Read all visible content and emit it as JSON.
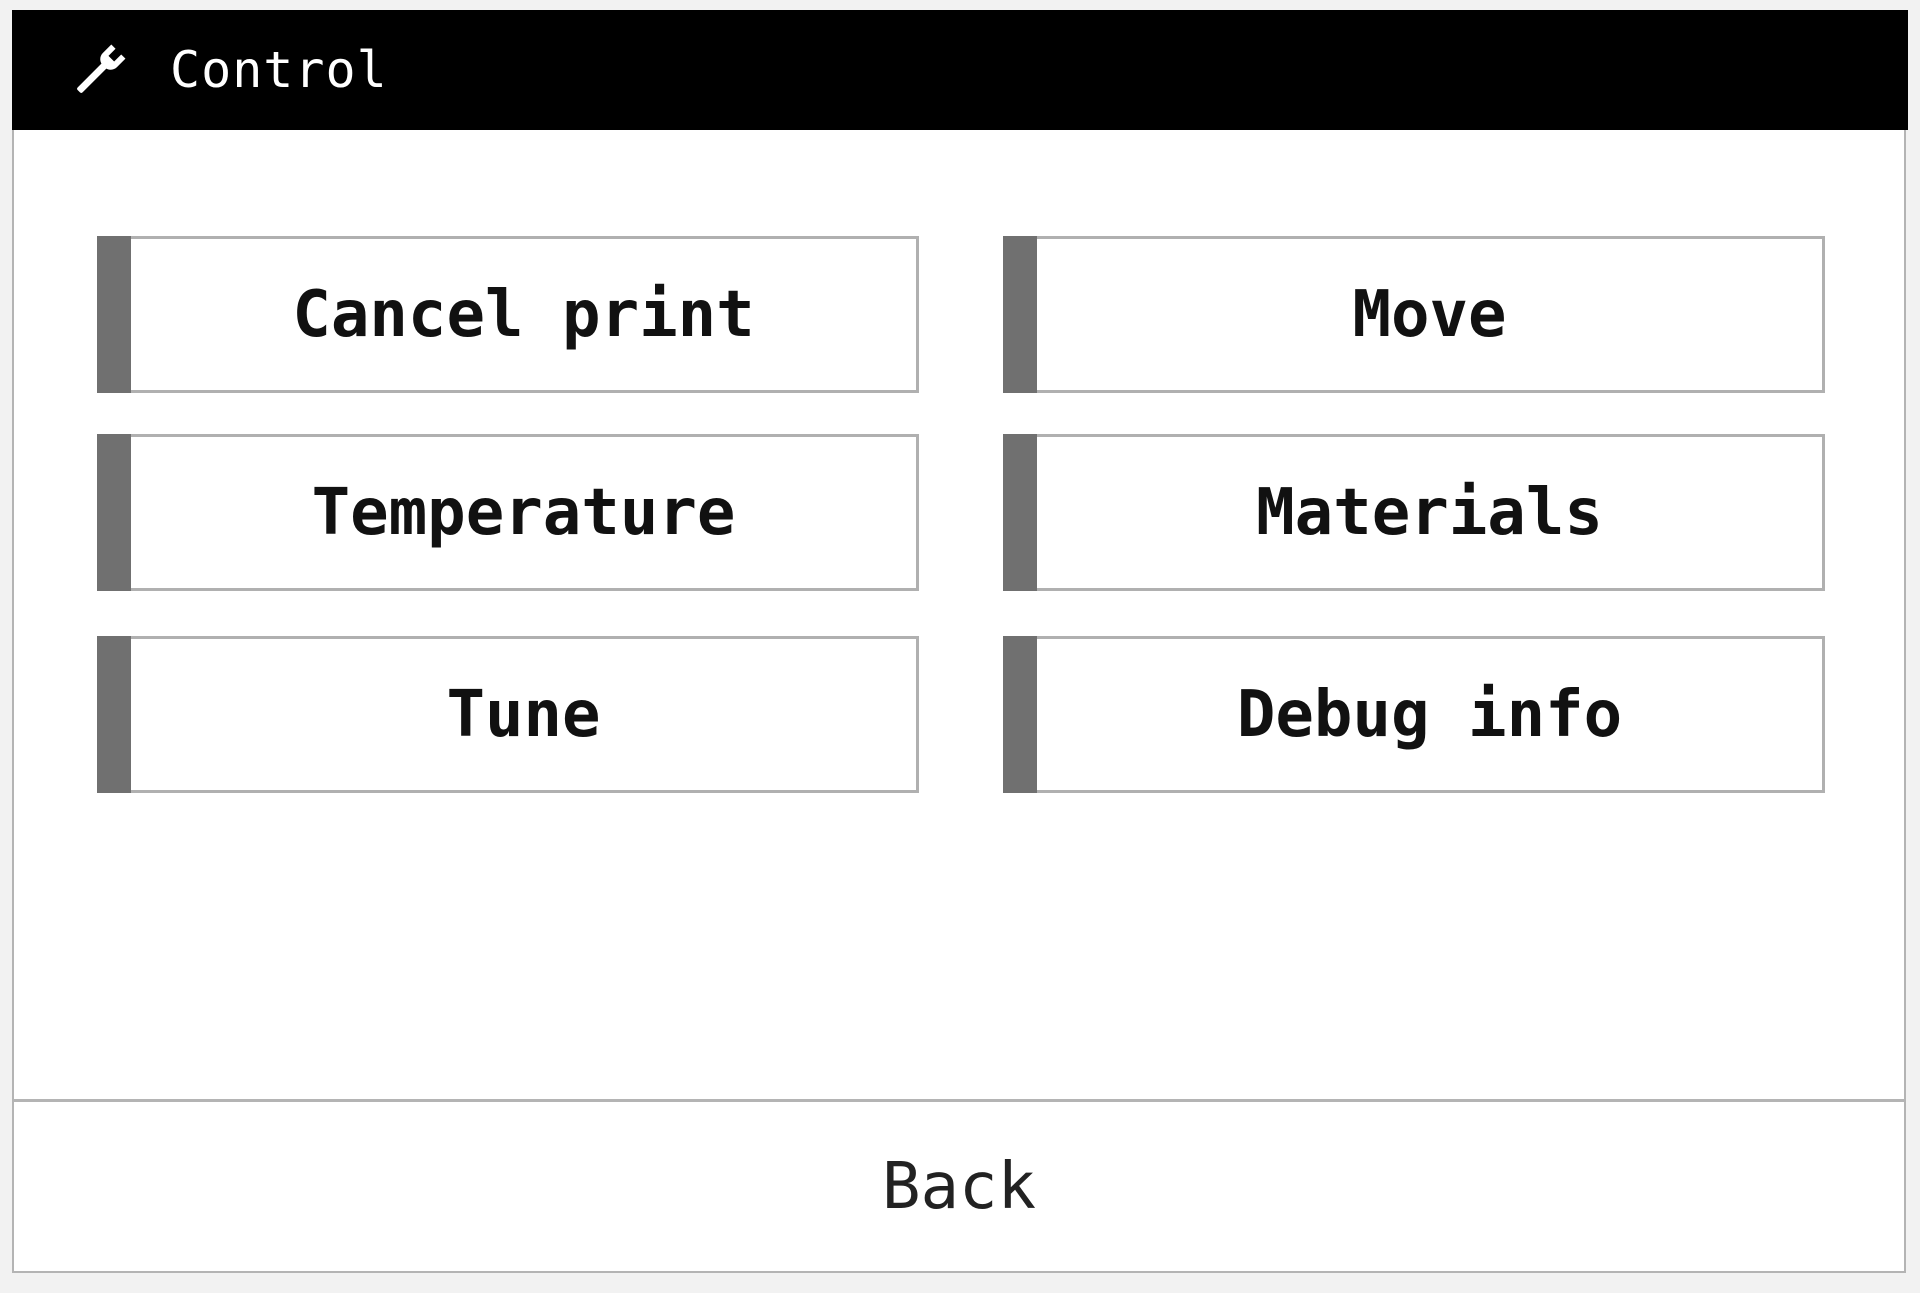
{
  "header": {
    "title": "Control",
    "icon": "wrench-icon"
  },
  "menu": {
    "items": [
      {
        "label": "Cancel print"
      },
      {
        "label": "Move"
      },
      {
        "label": "Temperature"
      },
      {
        "label": "Materials"
      },
      {
        "label": "Tune"
      },
      {
        "label": "Debug info"
      }
    ]
  },
  "footer": {
    "back_label": "Back"
  },
  "colors": {
    "header_bg": "#000000",
    "accent": "#707070",
    "border": "#b0b0b0"
  }
}
